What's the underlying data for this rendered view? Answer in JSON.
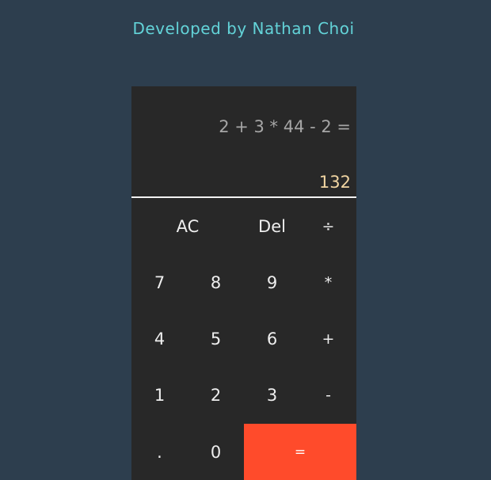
{
  "header": {
    "credit": "Developed by Nathan Choi"
  },
  "display": {
    "expression": "2 + 3 * 44 - 2 =",
    "result": "132"
  },
  "keys": {
    "clear": "AC",
    "delete": "Del",
    "divide": "÷",
    "seven": "7",
    "eight": "8",
    "nine": "9",
    "multiply": "*",
    "four": "4",
    "five": "5",
    "six": "6",
    "add": "+",
    "one": "1",
    "two": "2",
    "three": "3",
    "subtract": "-",
    "decimal": ".",
    "zero": "0",
    "equals": "="
  },
  "colors": {
    "page_background": "#2d3e4e",
    "calculator_background": "#282828",
    "credit_text": "#63d3d8",
    "result_text": "#f1d5a2",
    "equals_button": "#ff4b2b"
  }
}
